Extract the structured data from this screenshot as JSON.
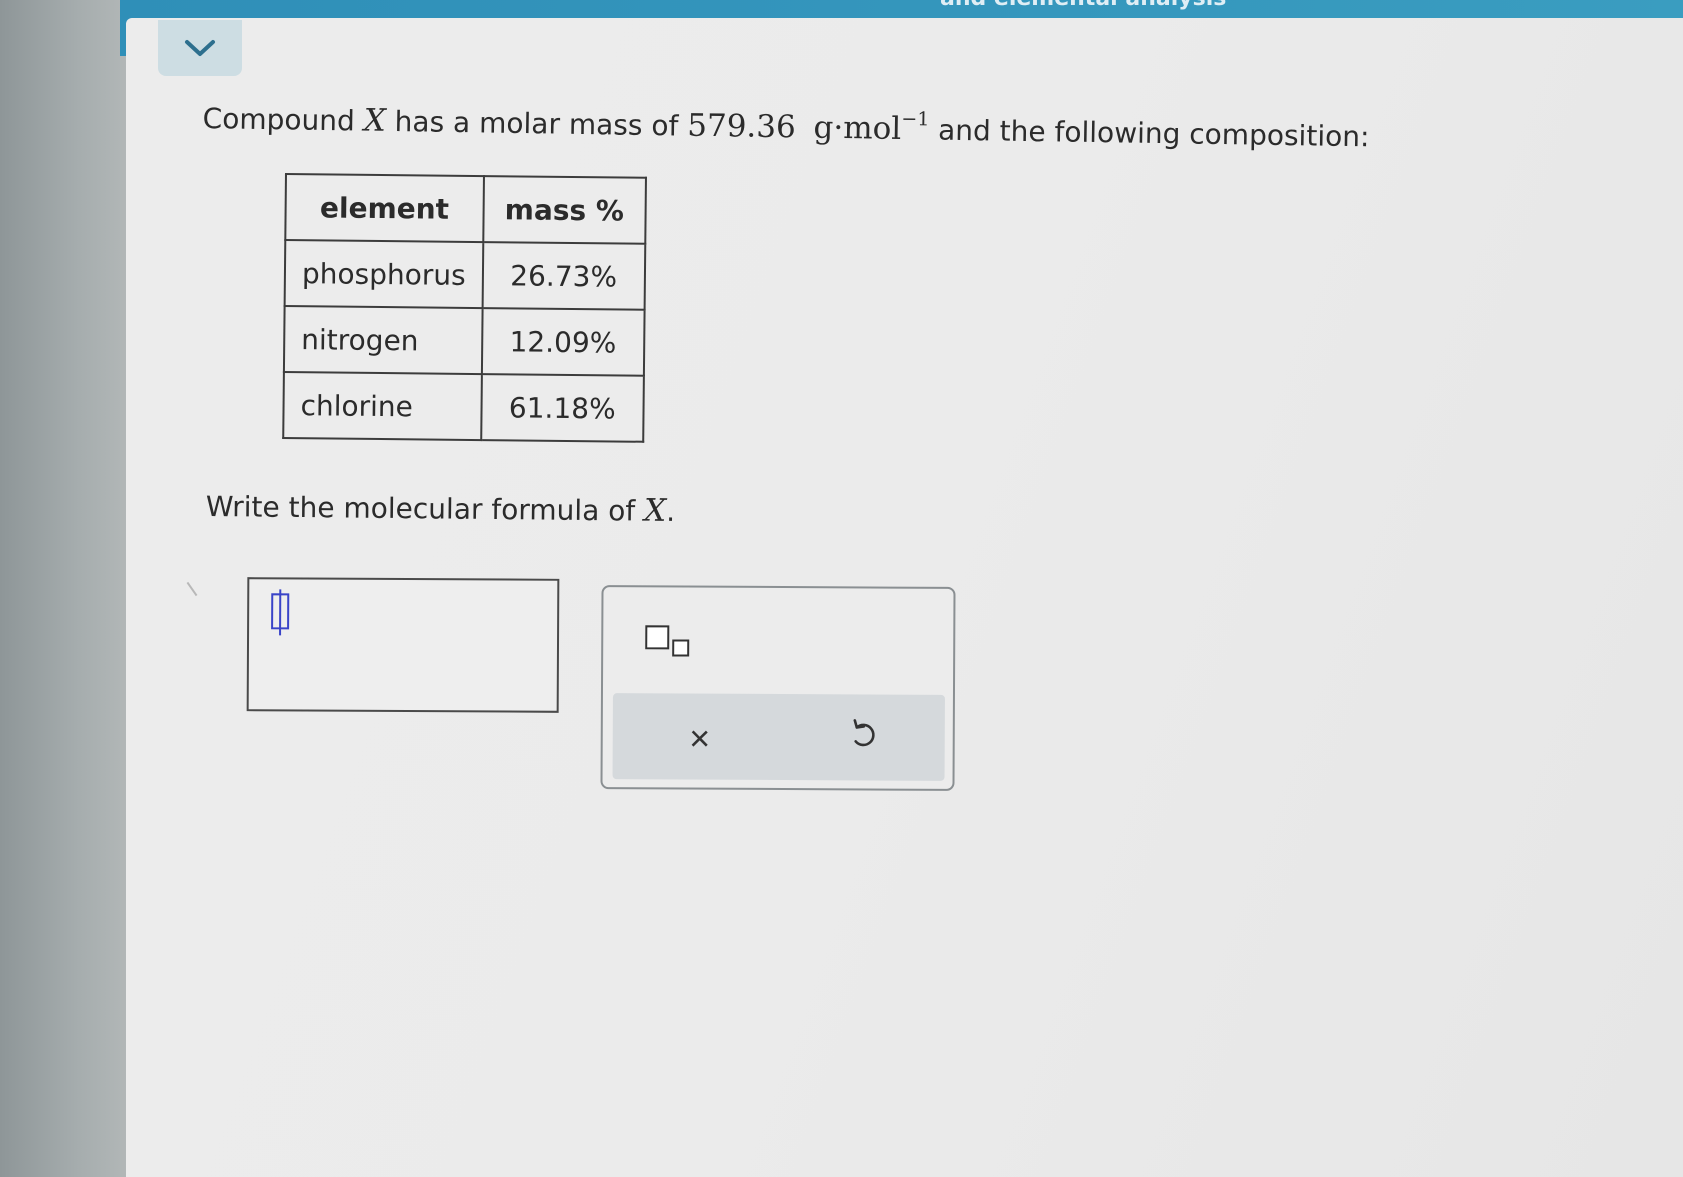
{
  "header": {
    "title": "and elemental analysis"
  },
  "question": {
    "prefix": "Compound ",
    "variable": "X",
    "middle": " has a molar mass of ",
    "molar_mass": "579.36",
    "unit": "g·mol",
    "unit_exponent": "−1",
    "suffix": " and the following composition:"
  },
  "composition_table": {
    "headers": [
      "element",
      "mass %"
    ],
    "rows": [
      [
        "phosphorus",
        "26.73%"
      ],
      [
        "nitrogen",
        "12.09%"
      ],
      [
        "chlorine",
        "61.18%"
      ]
    ]
  },
  "prompt": {
    "text": "Write the molecular formula of ",
    "variable": "X",
    "end": "."
  },
  "answer": {
    "value": ""
  },
  "palette": {
    "subscript_icon": "subscript-template-icon",
    "clear_icon": "close-icon",
    "clear_glyph": "×",
    "undo_icon": "undo-icon"
  },
  "colors": {
    "header_bar": "#3597bd",
    "cursor": "#3a44c8",
    "action_bar": "#d5d9dc"
  }
}
